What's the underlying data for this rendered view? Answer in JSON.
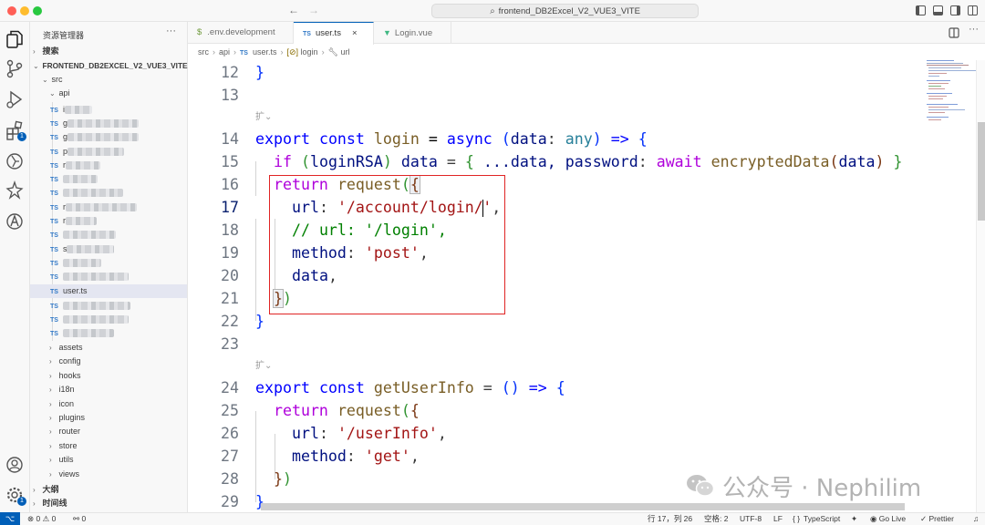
{
  "window": {
    "search_text": "frontend_DB2Excel_V2_VUE3_VITE"
  },
  "explorer": {
    "title": "资源管理器",
    "search_section": "搜索",
    "project_name": "FRONTEND_DB2EXCEL_V2_VUE3_VITE",
    "src_folder": "src",
    "api_folder": "api",
    "api_files_visible_prefix": [
      "i",
      "g",
      "g",
      "p",
      "r",
      "",
      "",
      "r",
      "r",
      "",
      "s",
      "",
      "",
      "",
      "",
      "",
      ""
    ],
    "active_file": "user.ts",
    "src_folders": [
      "assets",
      "config",
      "hooks",
      "i18n",
      "icon",
      "plugins",
      "router",
      "store",
      "utils",
      "views"
    ],
    "outline_section": "大纲",
    "timeline_section": "时间线",
    "extensions_badge": "1",
    "settings_badge": "1"
  },
  "tabs": [
    {
      "label": ".env.development",
      "icon": "$"
    },
    {
      "label": "user.ts",
      "icon": "TS",
      "active": true
    },
    {
      "label": "Login.vue",
      "icon": "V"
    }
  ],
  "breadcrumb": [
    "src",
    "api",
    "user.ts",
    "login",
    "url"
  ],
  "editor": {
    "current_line": 17,
    "code_lens": "扩",
    "lines": [
      {
        "n": "12"
      },
      {
        "n": "13"
      },
      {
        "n": "14"
      },
      {
        "n": "15"
      },
      {
        "n": "16"
      },
      {
        "n": "17"
      },
      {
        "n": "18"
      },
      {
        "n": "19"
      },
      {
        "n": "20"
      },
      {
        "n": "21"
      },
      {
        "n": "22"
      },
      {
        "n": "23"
      },
      {
        "n": "24"
      },
      {
        "n": "25"
      },
      {
        "n": "26"
      },
      {
        "n": "27"
      },
      {
        "n": "28"
      },
      {
        "n": "29"
      }
    ],
    "code": {
      "l14_kw_export": "export",
      "l14_kw_const": "const",
      "l14_fn": "login",
      "l14_eq": " = ",
      "l14_kw_async": "async",
      "l14_param": "data",
      "l14_type": "any",
      "l14_arrow": "=>",
      "l15_if": "if",
      "l15_cond": "loginRSA",
      "l15_data": "data",
      "l15_spread": "...data, ",
      "l15_prop": "password",
      "l15_await": "await",
      "l15_call": "encryptedData",
      "l15_arg": "data",
      "return": "return",
      "request": "request",
      "url_key": "url",
      "url_val_a": "'/account/login/",
      "url_val_b": "'",
      "comment": "// url: '/login',",
      "method_key": "method",
      "method_post": "'post'",
      "data_key": "data",
      "l24_fn": "getUserInfo",
      "url_userinfo": "'/userInfo'",
      "method_get": "'get'"
    }
  },
  "watermark": {
    "text": "公众号 · Nephilim"
  },
  "status": {
    "remote": "⌥",
    "errors": "0",
    "warnings": "0",
    "ports": "0",
    "position": "行 17，列 26",
    "spaces": "空格: 2",
    "encoding": "UTF-8",
    "eol": "LF",
    "language": "TypeScript",
    "golive": "Go Live",
    "prettier": "Prettier"
  },
  "colors": {
    "accent": "#005fb8",
    "highlight_box": "#e02424",
    "keyword": "#0000ff",
    "control": "#af00db",
    "function": "#795e26",
    "string": "#a31515",
    "property": "#001080",
    "comment": "#008000"
  }
}
